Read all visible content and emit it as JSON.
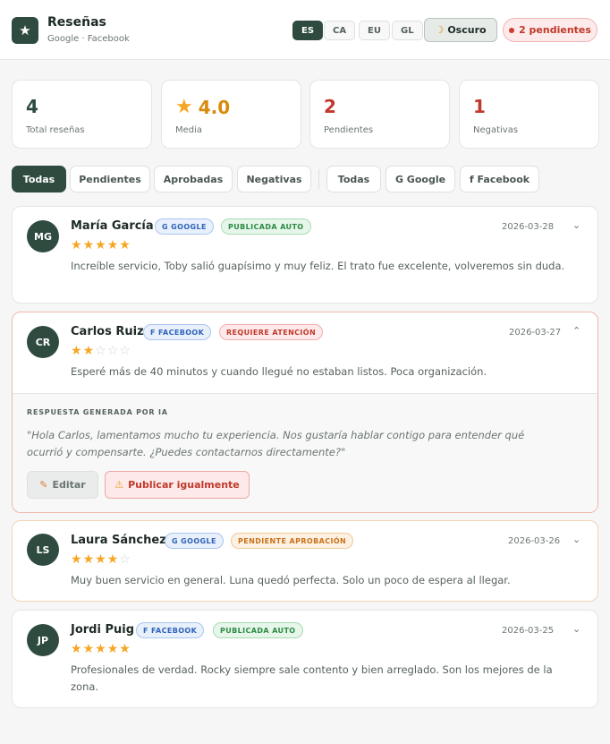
{
  "header": {
    "title": "Reseñas",
    "subtitle": "Google · Facebook",
    "languages": [
      "ES",
      "CA",
      "EU",
      "GL"
    ],
    "active_language": "ES",
    "dark_mode_label": "Oscuro",
    "pending_label": "2 pendientes"
  },
  "stats": [
    {
      "value": "4",
      "label": "Total reseñas",
      "color": "#2f4b40"
    },
    {
      "value": "4.0",
      "label": "Media",
      "color": "#d98a0b",
      "icon": "star-icon"
    },
    {
      "value": "2",
      "label": "Pendientes",
      "color": "#c0392b"
    },
    {
      "value": "1",
      "label": "Negativas",
      "color": "#c0392b"
    }
  ],
  "filters": {
    "status": [
      "Todas",
      "Pendientes",
      "Aprobadas",
      "Negativas"
    ],
    "source": [
      "Todas",
      "G Google",
      "f Facebook"
    ],
    "active_status": "Todas"
  },
  "reviews": [
    {
      "initials": "MG",
      "name": "María García",
      "source": "G GOOGLE",
      "status": "PUBLICADA AUTO",
      "date": "2026-03-28",
      "rating": 5,
      "text": "Increíble servicio, Toby salió guapísimo y muy feliz. El trato fue excelente, volveremos sin duda."
    },
    {
      "initials": "CR",
      "name": "Carlos Ruiz",
      "source": "F FACEBOOK",
      "status": "REQUIERE ATENCIÓN",
      "date": "2026-03-27",
      "rating": 2,
      "text": "Esperé más de 40 minutos y cuando llegué no estaban listos. Poca organización.",
      "ai_response": {
        "label": "RESPUESTA GENERADA POR IA",
        "text": "\"Hola Carlos, lamentamos mucho tu experiencia. Nos gustaría hablar contigo para entender qué ocurrió y compensarte. ¿Puedes contactarnos directamente?\"",
        "edit_label": "Editar",
        "publish_label": "Publicar igualmente"
      }
    },
    {
      "initials": "LS",
      "name": "Laura Sánchez",
      "source": "G GOOGLE",
      "status": "PENDIENTE APROBACIÓN",
      "date": "2026-03-26",
      "rating": 4,
      "text": "Muy buen servicio en general. Luna quedó perfecta. Solo un poco de espera al llegar."
    },
    {
      "initials": "JP",
      "name": "Jordi Puig",
      "source": "F FACEBOOK",
      "status": "PUBLICADA AUTO",
      "date": "2026-03-25",
      "rating": 5,
      "text": "Profesionales de verdad. Rocky siempre sale contento y bien arreglado. Son los mejores de la zona."
    }
  ]
}
